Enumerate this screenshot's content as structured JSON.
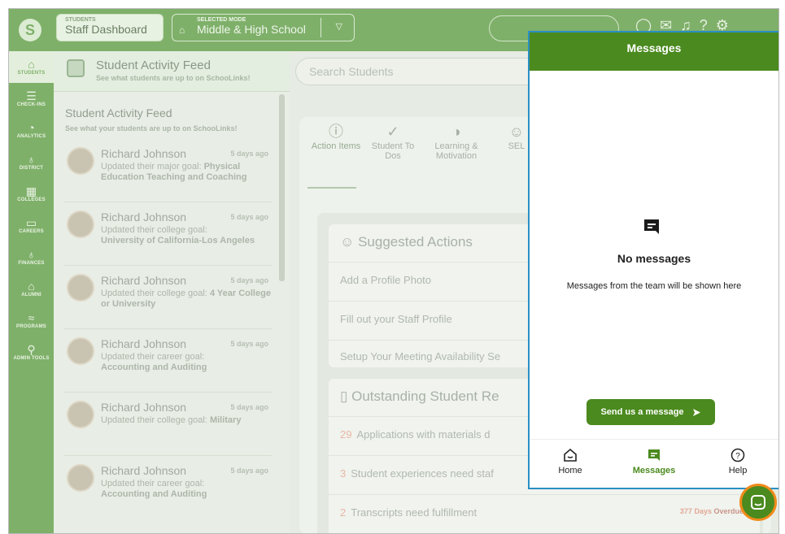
{
  "topbar": {
    "logo": "S",
    "section_small": "STUDENTS",
    "section_big": "Staff Dashboard",
    "mode_small": "SELECTED MODE",
    "mode_big": "Middle & High School"
  },
  "sidebar": {
    "items": [
      {
        "label": "STUDENTS",
        "icon": "home-icon",
        "glyph": "⌂"
      },
      {
        "label": "CHECK-INS",
        "icon": "checkin-icon",
        "glyph": "☰"
      },
      {
        "label": "ANALYTICS",
        "icon": "pie-chart-icon",
        "glyph": "◔"
      },
      {
        "label": "DISTRICT",
        "icon": "apple-icon",
        "glyph": "♁"
      },
      {
        "label": "COLLEGES",
        "icon": "college-icon",
        "glyph": "▦"
      },
      {
        "label": "CAREERS",
        "icon": "briefcase-icon",
        "glyph": "▭"
      },
      {
        "label": "FINANCES",
        "icon": "money-bag-icon",
        "glyph": "♁"
      },
      {
        "label": "ALUMNI",
        "icon": "graduation-cap-icon",
        "glyph": "⌂"
      },
      {
        "label": "PROGRAMS",
        "icon": "programs-icon",
        "glyph": "≈"
      },
      {
        "label": "ADMIN TOOLS",
        "icon": "wrench-icon",
        "glyph": "⚲"
      }
    ]
  },
  "feed_header": {
    "title": "Student Activity Feed",
    "subtitle": "See what students are up to on SchooLinks!"
  },
  "feed": {
    "title": "Student Activity Feed",
    "subtitle": "See what your students are up to on SchooLinks!",
    "items": [
      {
        "name": "Richard Johnson",
        "time": "5 days ago",
        "text": "Updated their major goal:",
        "bold": "Physical Education Teaching and Coaching"
      },
      {
        "name": "Richard Johnson",
        "time": "5 days ago",
        "text": "Updated their college goal:",
        "bold": "University of California-Los Angeles"
      },
      {
        "name": "Richard Johnson",
        "time": "5 days ago",
        "text": "Updated their college goal:",
        "bold": "4 Year College or University"
      },
      {
        "name": "Richard Johnson",
        "time": "5 days ago",
        "text": "Updated their career goal:",
        "bold": "Accounting and Auditing"
      },
      {
        "name": "Richard Johnson",
        "time": "5 days ago",
        "text": "Updated their college goal:",
        "bold": "Military"
      },
      {
        "name": "Richard Johnson",
        "time": "5 days ago",
        "text": "Updated their career goal:",
        "bold": "Accounting and Auditing"
      }
    ]
  },
  "search": {
    "placeholder": "Search Students"
  },
  "tabs": [
    {
      "label": "Action Items",
      "icon": "info-icon",
      "glyph": "ⓘ"
    },
    {
      "label": "Student To Dos",
      "icon": "check-circle-icon",
      "glyph": "✓"
    },
    {
      "label": "Learning & Motivation",
      "icon": "brain-icon",
      "glyph": "◑"
    },
    {
      "label": "SEL",
      "icon": "masks-icon",
      "glyph": "☺"
    }
  ],
  "suggested": {
    "title": "Suggested Actions",
    "rows": [
      "Add a Profile Photo",
      "Fill out your Staff Profile",
      "Setup Your Meeting Availability Se"
    ]
  },
  "outstanding": {
    "title": "Outstanding Student Re",
    "rows": [
      {
        "num": "29",
        "text": "Applications with materials d"
      },
      {
        "num": "3",
        "text": "Student experiences need staf"
      },
      {
        "num": "2",
        "text": "Transcripts need fulfillment",
        "days": "377 Days",
        "overdue": "Overdue"
      }
    ]
  },
  "messages": {
    "header": "Messages",
    "empty_title": "No messages",
    "empty_sub": "Messages from the team will be shown here",
    "send_label": "Send us a message",
    "nav": [
      "Home",
      "Messages",
      "Help"
    ]
  },
  "colors": {
    "brand": "#4b8a1e",
    "outline": "#2a8fc4",
    "launcher_ring": "#f08a1a"
  }
}
